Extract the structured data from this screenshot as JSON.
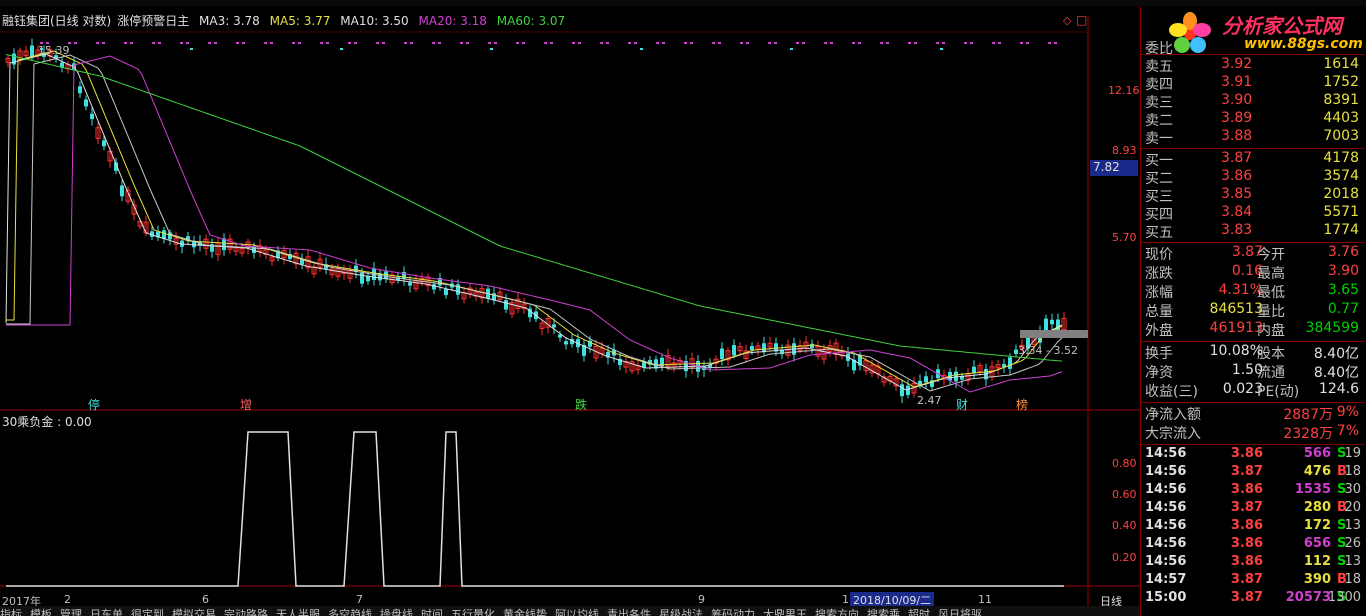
{
  "header": {
    "stock_name": "融钰集团(日线 对数)",
    "indicator_name": "涨停预警日主",
    "ma": [
      {
        "label": "MA3: 3.78",
        "color": "#e0e0e0"
      },
      {
        "label": "MA5: 3.77",
        "color": "#e8e040"
      },
      {
        "label": "MA10: 3.50",
        "color": "#e0e0e0"
      },
      {
        "label": "MA20: 3.18",
        "color": "#d040d0"
      },
      {
        "label": "MA60: 3.07",
        "color": "#40d040"
      }
    ]
  },
  "price_axis": {
    "ticks": [
      "12.16",
      "8.93",
      "5.70"
    ],
    "current_price_tag": "7.82",
    "high_label": "15.39",
    "low_label": "2.47",
    "range_label": "3.34 - 3.52"
  },
  "markers": [
    "停",
    "增",
    "跌",
    "财",
    "榜"
  ],
  "sub_chart": {
    "title": "30乘负金 : 0.00",
    "ticks": [
      "0.80",
      "0.60",
      "0.40",
      "0.20"
    ]
  },
  "time_axis": {
    "labels": [
      "2017年",
      "2",
      "6",
      "7",
      "9",
      "1",
      "11"
    ],
    "cursor_date": "2018/10/09/二",
    "period": "日线"
  },
  "bottom_tabs": [
    "指标",
    "模板",
    "管理",
    "日东单",
    "很定到",
    "模拟交易",
    "完动路路",
    "天人半服",
    "多空趋线",
    "操盘线",
    "时间",
    "五行量化",
    "黄金线势",
    "阿以均线",
    "青出各件",
    "星级战法",
    "筹码动力",
    "大鼎男王",
    "搜索方向",
    "搜索乘",
    "超时",
    "风日将驱"
  ],
  "order_book": {
    "header": "委比",
    "sell": [
      {
        "label": "卖五",
        "price": "3.92",
        "vol": "1614"
      },
      {
        "label": "卖四",
        "price": "3.91",
        "vol": "1752"
      },
      {
        "label": "卖三",
        "price": "3.90",
        "vol": "8391"
      },
      {
        "label": "卖二",
        "price": "3.89",
        "vol": "4403"
      },
      {
        "label": "卖一",
        "price": "3.88",
        "vol": "7003"
      }
    ],
    "buy": [
      {
        "label": "买一",
        "price": "3.87",
        "vol": "4178"
      },
      {
        "label": "买二",
        "price": "3.86",
        "vol": "3574"
      },
      {
        "label": "买三",
        "price": "3.85",
        "vol": "2018"
      },
      {
        "label": "买四",
        "price": "3.84",
        "vol": "5571"
      },
      {
        "label": "买五",
        "price": "3.83",
        "vol": "1774"
      }
    ]
  },
  "quote": [
    {
      "l1": "现价",
      "v1": "3.87",
      "c1": "#ff4040",
      "l2": "今开",
      "v2": "3.76",
      "c2": "#ff4040"
    },
    {
      "l1": "涨跌",
      "v1": "0.16",
      "c1": "#ff4040",
      "l2": "最高",
      "v2": "3.90",
      "c2": "#ff4040"
    },
    {
      "l1": "涨幅",
      "v1": "4.31%",
      "c1": "#ff4040",
      "l2": "最低",
      "v2": "3.65",
      "c2": "#00d000"
    },
    {
      "l1": "总量",
      "v1": "846513",
      "c1": "#e8e040",
      "l2": "量比",
      "v2": "0.77",
      "c2": "#00d000"
    },
    {
      "l1": "外盘",
      "v1": "461913",
      "c1": "#ff4040",
      "l2": "内盘",
      "v2": "384599",
      "c2": "#00d000"
    }
  ],
  "stats": [
    {
      "l1": "换手",
      "v1": "10.08%",
      "l2": "股本",
      "v2": "8.40亿"
    },
    {
      "l1": "净资",
      "v1": "1.50",
      "l2": "流通",
      "v2": "8.40亿"
    },
    {
      "l1": "收益(三)",
      "v1": "0.023",
      "l2": "PE(动)",
      "v2": "124.6"
    }
  ],
  "flow": [
    {
      "label": "净流入额",
      "value": "2887万",
      "pct": "9%"
    },
    {
      "label": "大宗流入",
      "value": "2328万",
      "pct": "7%"
    }
  ],
  "ticks": [
    {
      "time": "14:56",
      "price": "3.86",
      "vol": "566",
      "side": "S",
      "n": "19",
      "vc": "#d040d0"
    },
    {
      "time": "14:56",
      "price": "3.87",
      "vol": "476",
      "side": "B",
      "n": "18",
      "vc": "#e8e040"
    },
    {
      "time": "14:56",
      "price": "3.86",
      "vol": "1535",
      "side": "S",
      "n": "30",
      "vc": "#d040d0"
    },
    {
      "time": "14:56",
      "price": "3.87",
      "vol": "280",
      "side": "B",
      "n": "20",
      "vc": "#e8e040"
    },
    {
      "time": "14:56",
      "price": "3.86",
      "vol": "172",
      "side": "S",
      "n": "13",
      "vc": "#e8e040"
    },
    {
      "time": "14:56",
      "price": "3.86",
      "vol": "656",
      "side": "S",
      "n": "26",
      "vc": "#d040d0"
    },
    {
      "time": "14:56",
      "price": "3.86",
      "vol": "112",
      "side": "S",
      "n": "13",
      "vc": "#e8e040"
    },
    {
      "time": "14:57",
      "price": "3.87",
      "vol": "390",
      "side": "B",
      "n": "18",
      "vc": "#e8e040"
    },
    {
      "time": "15:00",
      "price": "3.87",
      "vol": "20573",
      "side": "S",
      "n": "1300",
      "vc": "#d040d0"
    }
  ],
  "logo": {
    "text": "分析家公式网",
    "url_text": "www.88gs.com"
  }
}
